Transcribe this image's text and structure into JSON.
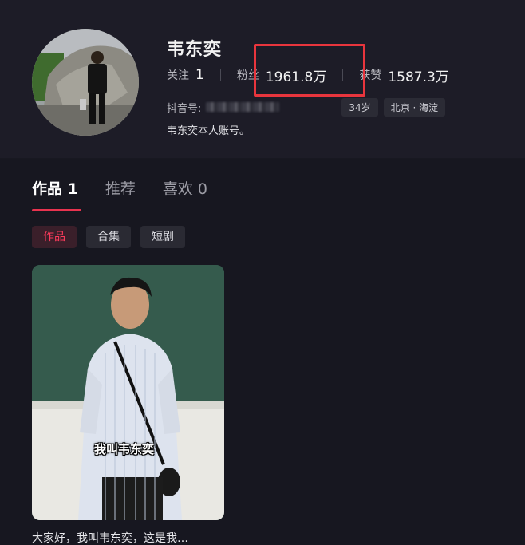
{
  "profile": {
    "username": "韦东奕",
    "stats": [
      {
        "label": "关注",
        "value": "1"
      },
      {
        "label": "粉丝",
        "value": "1961.8万"
      },
      {
        "label": "获赞",
        "value": "1587.3万"
      }
    ],
    "id_label": "抖音号:",
    "tags": [
      "34岁",
      "北京 · 海淀"
    ],
    "bio": "韦东奕本人账号。"
  },
  "tabs": [
    {
      "label": "作品 1",
      "active": true
    },
    {
      "label": "推荐",
      "active": false
    },
    {
      "label": "喜欢 0",
      "active": false
    }
  ],
  "filter_chips": [
    {
      "label": "作品",
      "active": true
    },
    {
      "label": "合集",
      "active": false
    },
    {
      "label": "短剧",
      "active": false
    }
  ],
  "video": {
    "caption": "我叫韦东奕",
    "title": "大家好，我叫韦东奕，这是我…"
  },
  "colors": {
    "accent": "#e8334f",
    "highlight_box": "#e8353d",
    "background": "#17171f"
  }
}
